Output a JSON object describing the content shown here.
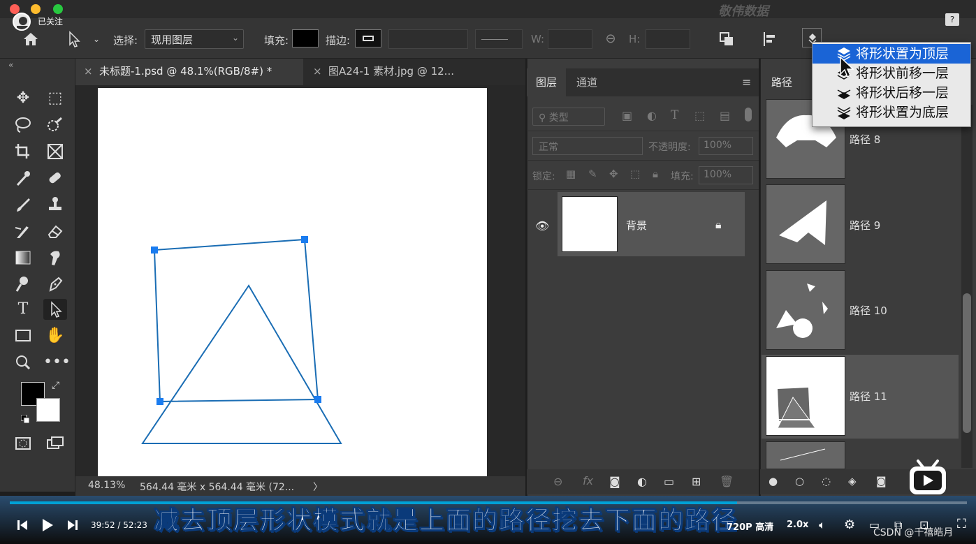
{
  "top": {
    "watermark": "敬伟数据",
    "follow_label": "已关注"
  },
  "options": {
    "select_label": "选择:",
    "select_value": "现用图层",
    "fill_label": "填充:",
    "stroke_label": "描边:",
    "w_label": "W:",
    "h_label": "H:",
    "fill_color": "#000000"
  },
  "tabs": {
    "doc1": "未标题-1.psd @ 48.1%(RGB/8#) *",
    "doc2": "图A24-1 素材.jpg @ 12..."
  },
  "status": {
    "zoom": "48.13%",
    "doc_size": "564.44 毫米 x 564.44 毫米 (72...",
    "arrow": "〉"
  },
  "layers": {
    "tab_layers": "图层",
    "tab_channels": "通道",
    "filter_placeholder": "类型",
    "blend_mode": "正常",
    "opacity_label": "不透明度:",
    "opacity_value": "100%",
    "lock_label": "锁定:",
    "fill_label": "填充:",
    "fill_value": "100%",
    "bg_layer_name": "背景"
  },
  "paths": {
    "tab": "路径",
    "items": [
      {
        "name": "路径 8"
      },
      {
        "name": "路径 9"
      },
      {
        "name": "路径 10"
      },
      {
        "name": "路径 11"
      }
    ]
  },
  "menu": {
    "items": [
      {
        "label": "将形状置为顶层",
        "highlighted": true
      },
      {
        "label": "将形状前移一层",
        "highlighted": false
      },
      {
        "label": "将形状后移一层",
        "highlighted": false
      },
      {
        "label": "将形状置为底层",
        "highlighted": false
      }
    ]
  },
  "video": {
    "subtitle": "减去顶层形状模式就是上面的路径挖去下面的路径",
    "time": "39:52 / 52:23",
    "quality": "720P 高清",
    "speed": "2.0x",
    "progress": 0.76,
    "credit": "CSDN @千禧皓月"
  }
}
